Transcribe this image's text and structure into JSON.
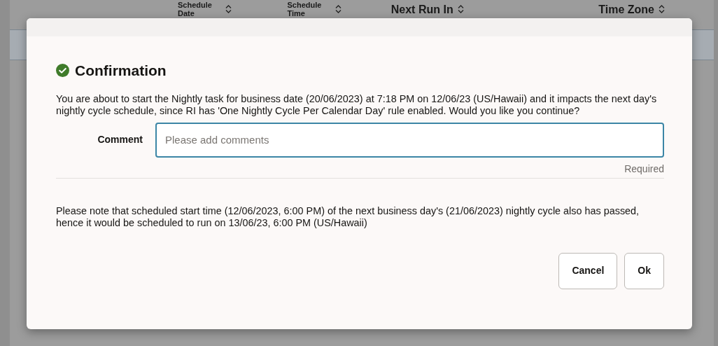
{
  "background_table": {
    "columns": [
      {
        "label": "Schedule Date"
      },
      {
        "label": "Schedule Time"
      },
      {
        "label": "Next Run In"
      },
      {
        "label": "Time Zone"
      }
    ]
  },
  "dialog": {
    "title": "Confirmation",
    "message": "You are about to start the Nightly task for business date (20/06/2023) at 7:18 PM on 12/06/23 (US/Hawaii) and it impacts the next day's nightly cycle schedule, since RI has 'One Nightly Cycle Per Calendar Day' rule enabled. Would you like you continue?",
    "comment": {
      "label": "Comment",
      "placeholder": "Please add comments",
      "hint": "Required"
    },
    "note": "Please note that scheduled start time (12/06/2023, 6:00 PM) of the next business day's (21/06/2023) nightly cycle also has passed, hence it would be scheduled to run on 13/06/23, 6:00 PM (US/Hawaii)",
    "buttons": [
      {
        "label": "Cancel"
      },
      {
        "label": "Ok"
      }
    ]
  }
}
